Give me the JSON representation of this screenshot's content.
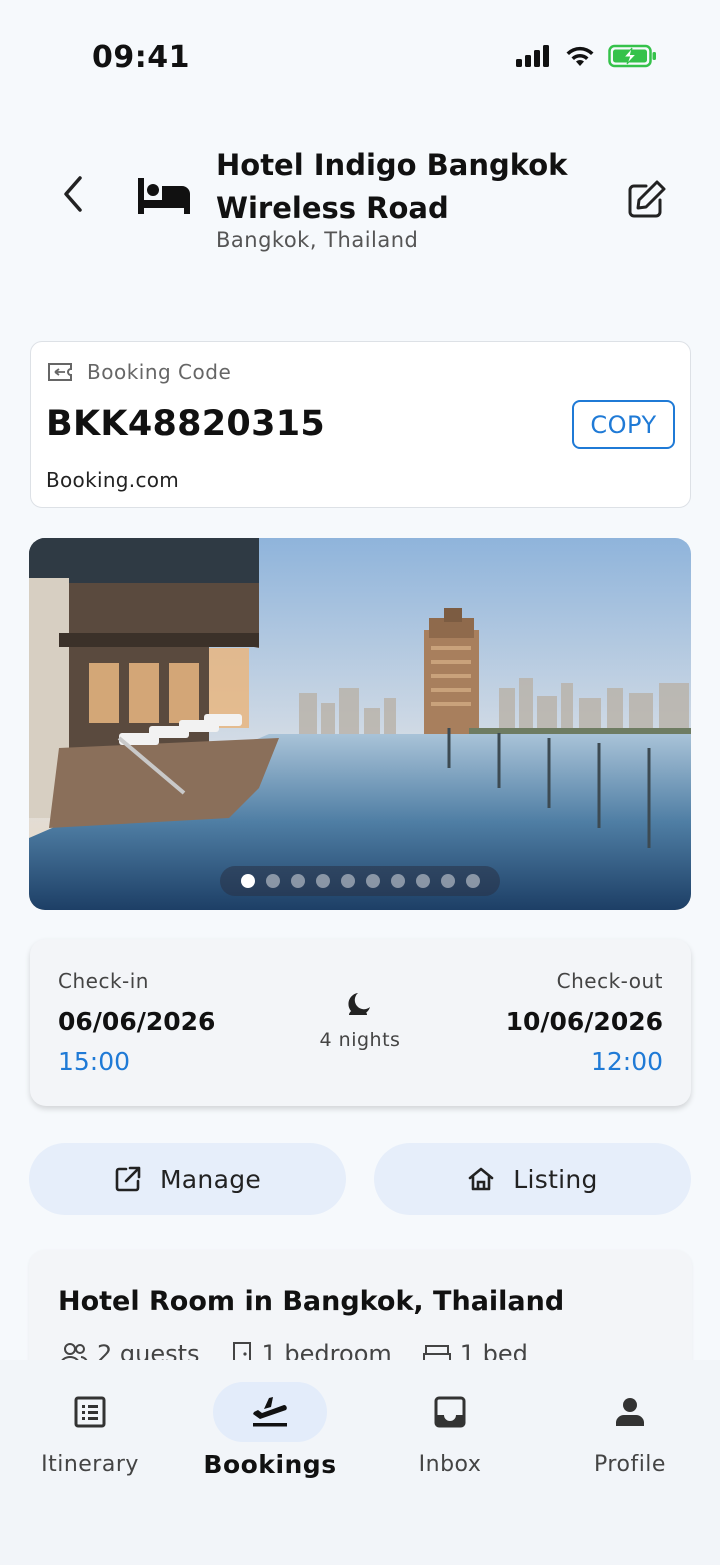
{
  "status_bar": {
    "time": "09:41"
  },
  "header": {
    "hotel_name": "Hotel Indigo Bangkok Wireless Road",
    "location": "Bangkok, Thailand",
    "back_icon": "chevron-left-icon",
    "hotel_icon": "bed-icon",
    "edit_icon": "edit-icon"
  },
  "booking_code": {
    "label": "Booking Code",
    "code": "BKK48820315",
    "provider": "Booking.com",
    "copy_label": "COPY"
  },
  "gallery": {
    "image_count": 10,
    "active_index": 0
  },
  "dates": {
    "checkin_label": "Check-in",
    "checkin_date": "06/06/2026",
    "checkin_time": "15:00",
    "nights": "4 nights",
    "checkout_label": "Check-out",
    "checkout_date": "10/06/2026",
    "checkout_time": "12:00"
  },
  "actions": {
    "manage_label": "Manage",
    "listing_label": "Listing"
  },
  "room": {
    "title": "Hotel Room in Bangkok, Thailand",
    "guests": "2 guests",
    "bedrooms": "1 bedroom",
    "beds": "1 bed"
  },
  "nav": {
    "items": [
      {
        "label": "Itinerary",
        "icon": "list-icon"
      },
      {
        "label": "Bookings",
        "icon": "flight-takeoff-icon"
      },
      {
        "label": "Inbox",
        "icon": "inbox-icon"
      },
      {
        "label": "Profile",
        "icon": "person-icon"
      }
    ],
    "active": "Bookings"
  },
  "colors": {
    "accent": "#1f7ad6",
    "background": "#f6f9fc",
    "pill": "#e6eefa"
  }
}
